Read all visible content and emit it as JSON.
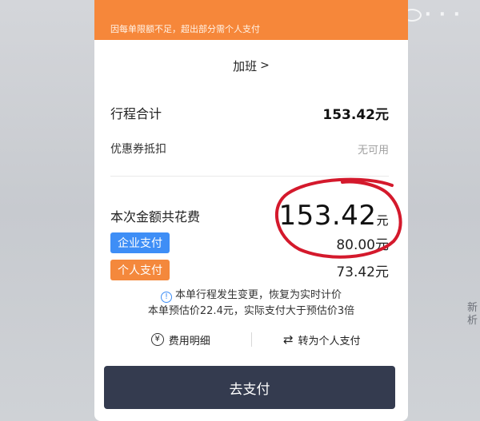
{
  "notice": {
    "text": "因每单限额不足，超出部分需个人支付"
  },
  "overtime": {
    "label": "加班",
    "chevron": ">"
  },
  "trip_total": {
    "label": "行程合计",
    "amount": "153.42元"
  },
  "coupon": {
    "label": "优惠券抵扣",
    "value": "无可用"
  },
  "cost": {
    "label": "本次金额共花费",
    "amount": "153.42",
    "unit": "元"
  },
  "enterprise": {
    "label": "企业支付",
    "amount": "80.00元"
  },
  "personal": {
    "label": "个人支付",
    "amount": "73.42元"
  },
  "info": {
    "line1": "本单行程发生变更，恢复为实时计价",
    "line2": "本单预估价22.4元，实际支付大于预估价3倍"
  },
  "actions": {
    "fee_detail": "费用明细",
    "to_personal": "转为个人支付"
  },
  "pay_button": "去支付",
  "icons": {
    "info": "info-circle-icon",
    "fee": "yen-coin-icon",
    "swap": "swap-arrows-icon",
    "chevron": "chevron-right-icon"
  },
  "colors": {
    "notice_bg": "#f6873a",
    "enterprise_pill": "#3e8ef6",
    "personal_pill": "#f4883c",
    "pay_button_bg": "#343b4f",
    "annotation_circle": "#d4192c"
  }
}
